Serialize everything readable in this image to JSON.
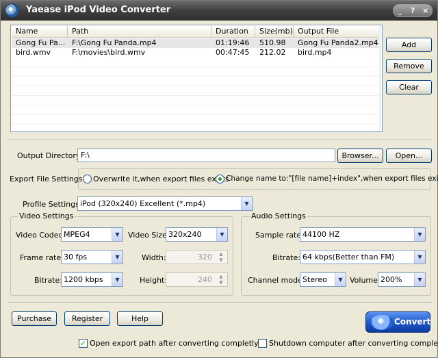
{
  "window": {
    "title": "Yaease iPod Video Converter",
    "controls": [
      "_",
      "?",
      "×"
    ]
  },
  "file_list": {
    "columns": [
      "Name",
      "Path",
      "Duration",
      "Size(mb)",
      "Output File"
    ],
    "rows": [
      [
        "Gong Fu Pa...",
        "F:\\Gong Fu Panda.mp4",
        "01:19:46",
        "510.98",
        "Gong Fu Panda2.mp4"
      ],
      [
        "bird.wmv",
        "F:\\movies\\bird.wmv",
        "00:47:45",
        "212.02",
        "bird.mp4"
      ]
    ]
  },
  "list_buttons": {
    "add": "Add",
    "remove": "Remove",
    "clear": "Clear"
  },
  "output": {
    "label": "Output Directory:",
    "value": "F:\\",
    "browse": "Browser...",
    "open": "Open..."
  },
  "export": {
    "label": "Export File Settings:",
    "option_overwrite": "Overwrite it,when export files exists",
    "option_rename": "Change name to:\"[file name]+index\",when export files exists",
    "selected": "rename"
  },
  "profile": {
    "label": "Profile Settings:",
    "value": "iPod (320x240) Excellent (*.mp4)"
  },
  "video": {
    "title": "Video Settings",
    "codec_label": "Video Codec:",
    "codec": "MPEG4",
    "size_label": "Video Size:",
    "size": "320x240",
    "framerate_label": "Frame rate:",
    "framerate": "30 fps",
    "width_label": "Width:",
    "width": "320",
    "bitrate_label": "Bitrate:",
    "bitrate": "1200 kbps",
    "height_label": "Height:",
    "height": "240"
  },
  "audio": {
    "title": "Audio Settings",
    "samplerate_label": "Sample rate:",
    "samplerate": "44100 HZ",
    "bitrate_label": "Bitrate:",
    "bitrate": "64  kbps(Better than FM)",
    "channel_label": "Channel mode:",
    "channel": "Stereo",
    "volume_label": "Volume:",
    "volume": "200%"
  },
  "bottom": {
    "purchase": "Purchase",
    "register": "Register",
    "help": "Help",
    "convert": "Convert",
    "open_after": "Open export path after converting completly",
    "open_after_checked": true,
    "shutdown": "Shutdown computer after converting completly",
    "shutdown_checked": false
  }
}
